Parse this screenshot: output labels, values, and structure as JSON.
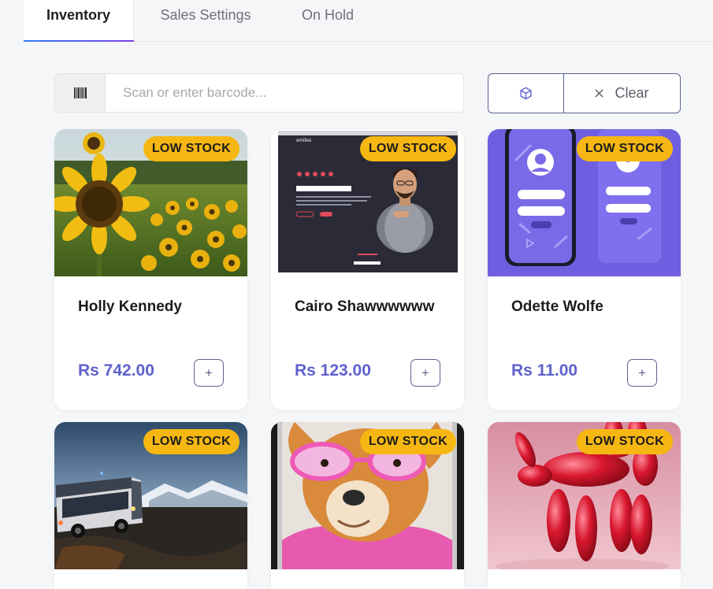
{
  "tabs": [
    {
      "label": "Inventory",
      "active": true
    },
    {
      "label": "Sales Settings",
      "active": false
    },
    {
      "label": "On Hold",
      "active": false
    }
  ],
  "search": {
    "placeholder": "Scan or enter barcode...",
    "icon": "barcode-icon"
  },
  "actions": {
    "cube_icon": "cube-icon",
    "clear_icon": "close-icon",
    "clear_label": "Clear"
  },
  "products": [
    {
      "name": "Holly Kennedy",
      "price": "Rs 742.00",
      "badge": "LOW STOCK",
      "add_label": "+",
      "image": "sunflower-field"
    },
    {
      "name": "Cairo Shawwwwww",
      "price": "Rs 123.00",
      "badge": "LOW STOCK",
      "add_label": "+",
      "image": "portfolio-website"
    },
    {
      "name": "Odette Wolfe",
      "price": "Rs 11.00",
      "badge": "LOW STOCK",
      "add_label": "+",
      "image": "mobile-login-mockup"
    },
    {
      "badge": "LOW STOCK",
      "image": "bus-at-dusk"
    },
    {
      "badge": "LOW STOCK",
      "image": "chihuahua-pink-glasses"
    },
    {
      "badge": "LOW STOCK",
      "image": "red-balloon-dog"
    }
  ],
  "colors": {
    "accent": "#5f61cc",
    "badge": "#f6b712",
    "border": "#5a6290"
  }
}
